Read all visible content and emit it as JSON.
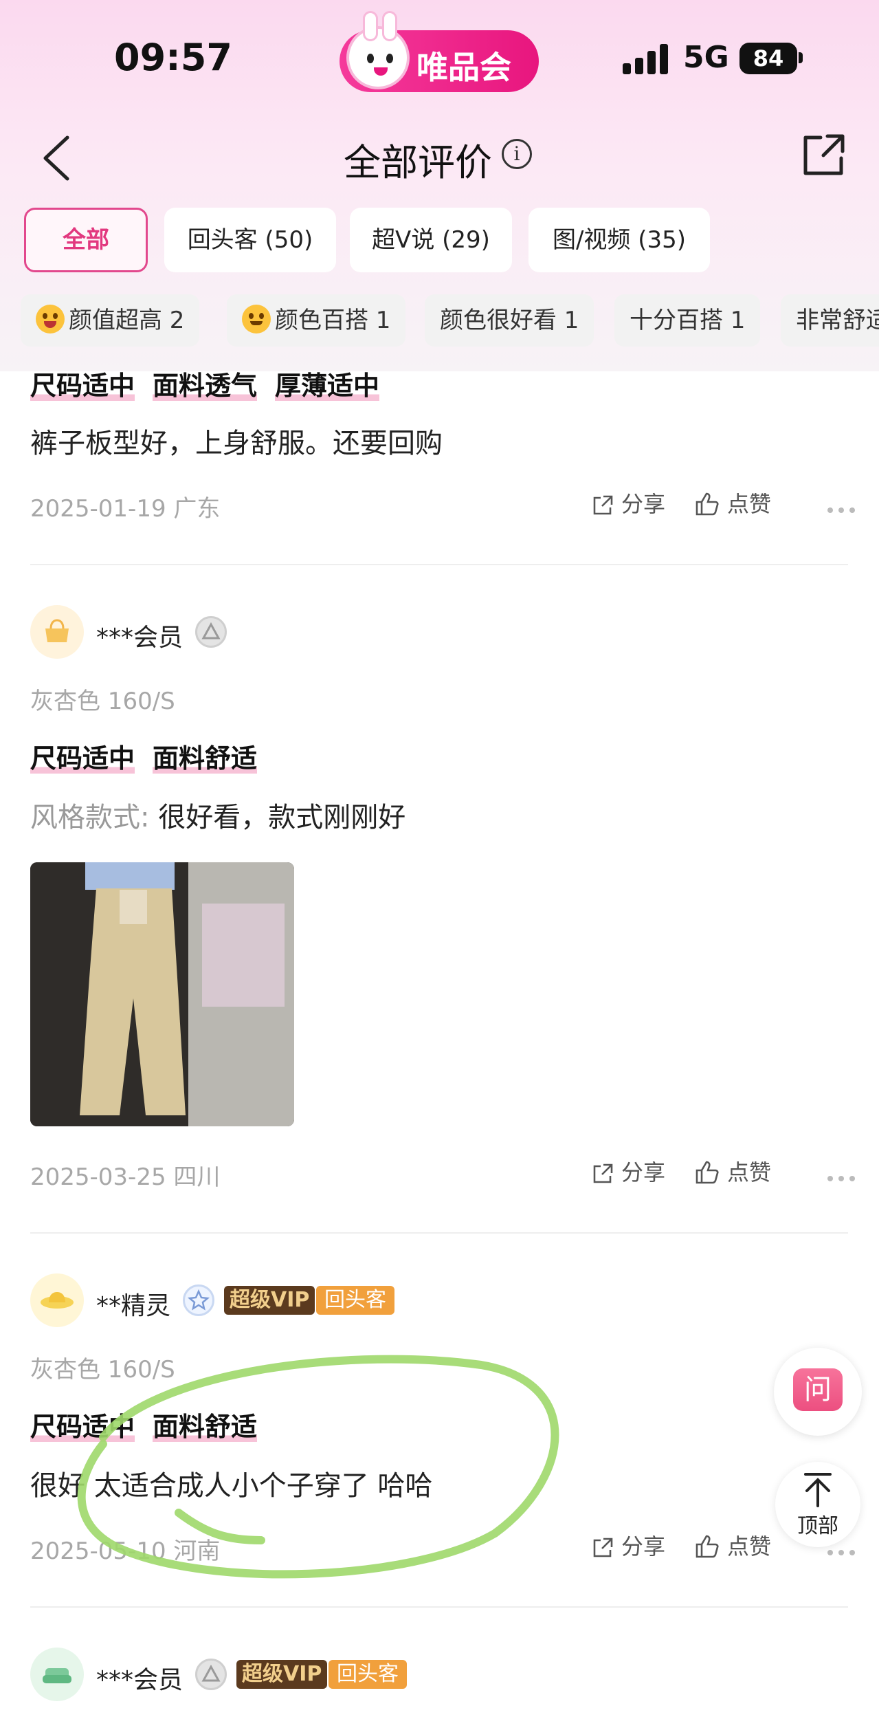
{
  "status_bar": {
    "time": "09:57",
    "brand": "唯品会",
    "network": "5G",
    "battery": "84"
  },
  "nav": {
    "title": "全部评价"
  },
  "filter_tabs": [
    {
      "label": "全部",
      "active": true
    },
    {
      "label": "回头客 (50)",
      "active": false
    },
    {
      "label": "超V说 (29)",
      "active": false
    },
    {
      "label": "图/视频 (35)",
      "active": false
    }
  ],
  "tag_chips": [
    {
      "label": "颜值超高 2",
      "emoji": "laughing-emoji"
    },
    {
      "label": "颜色百搭 1",
      "emoji": "smile-emoji"
    },
    {
      "label": "颜色很好看 1"
    },
    {
      "label": "十分百搭 1"
    },
    {
      "label": "非常舒适"
    }
  ],
  "reviews": [
    {
      "tags": [
        "尺码适中",
        "面料透气",
        "厚薄适中"
      ],
      "text": "裤子板型好，上身舒服。还要回购",
      "date_location": "2025-01-19 广东",
      "share_label": "分享",
      "like_label": "点赞"
    },
    {
      "user": "***会员",
      "spec": "灰杏色 160/S",
      "tags": [
        "尺码适中",
        "面料舒适"
      ],
      "text_prefix": "风格款式:",
      "text": "很好看，款式刚刚好",
      "date_location": "2025-03-25 四川",
      "share_label": "分享",
      "like_label": "点赞"
    },
    {
      "user": "**精灵",
      "vip_badge": "超级VIP",
      "return_badge": "回头客",
      "spec": "灰杏色 160/S",
      "tags": [
        "尺码适中",
        "面料舒适"
      ],
      "text": "很好 太适合成人小个子穿了 哈哈",
      "date_location": "2025-05-10 河南",
      "share_label": "分享",
      "like_label": "点赞"
    },
    {
      "user": "***会员",
      "vip_badge": "超级VIP",
      "return_badge": "回头客"
    }
  ],
  "floating": {
    "ask_label": "问",
    "top_label": "顶部"
  },
  "colors": {
    "accent": "#e2387f",
    "annotation": "#9fd86a",
    "vip_bg": "#5b3a1e",
    "return_bg": "#f1a03c"
  }
}
